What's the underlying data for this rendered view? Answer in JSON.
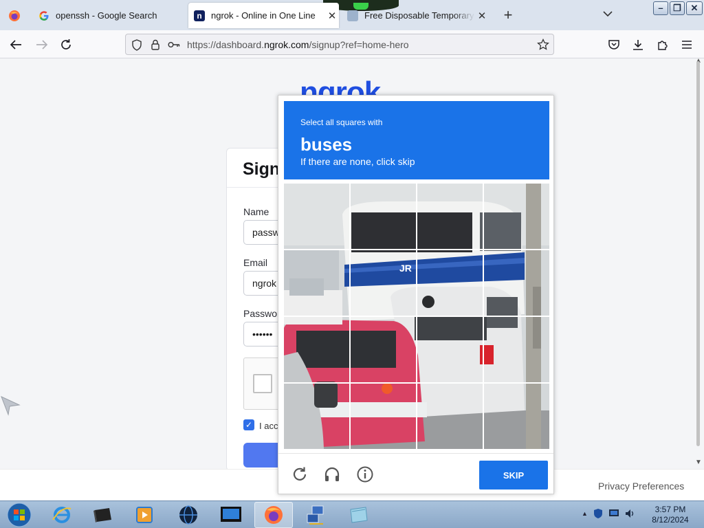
{
  "browser": {
    "tabs": [
      {
        "title": "openssh - Google Search",
        "icon": "google-icon"
      },
      {
        "title": "ngrok - Online in One Line",
        "icon": "ngrok-icon",
        "active": true
      },
      {
        "title": "Free Disposable Temporary & F",
        "icon": "mail-icon"
      }
    ],
    "new_tab_symbol": "+",
    "tab_list_symbol": "⌄",
    "url_prefix": "https://dashboard.",
    "url_domain": "ngrok.com",
    "url_path": "/signup?ref=home-hero",
    "close_symbol": "✕"
  },
  "page": {
    "logo": "ngrok",
    "card_title": "Sign up",
    "fields": [
      {
        "label": "Name",
        "value": "passw"
      },
      {
        "label": "Email",
        "value": "ngrok"
      },
      {
        "label": "Password",
        "value": "••••••"
      }
    ],
    "agree_text": "I accept",
    "privacy_link": "Privacy Preferences"
  },
  "captcha": {
    "instruction": "Select all squares with",
    "target": "buses",
    "note": "If there are none, click skip",
    "skip_label": "SKIP",
    "footer_icons": [
      "refresh-icon",
      "audio-icon",
      "info-icon"
    ]
  },
  "taskbar": {
    "time": "3:57 PM",
    "date": "8/12/2024"
  },
  "colors": {
    "captcha_blue": "#1a73e8",
    "ngrok_blue": "#1f4ee0"
  }
}
